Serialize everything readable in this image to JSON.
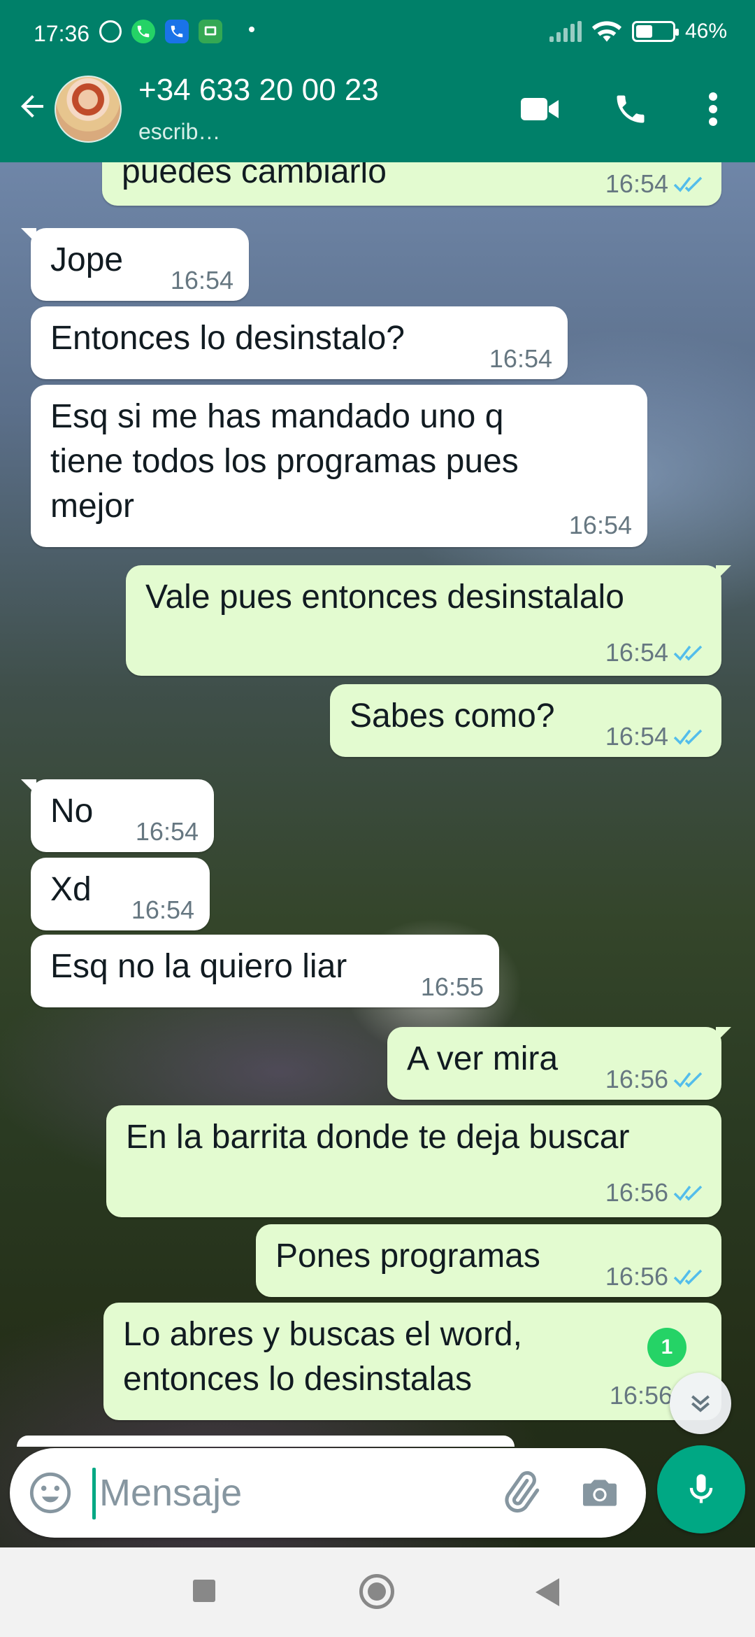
{
  "status_bar": {
    "time": "17:36",
    "battery": "46%",
    "battery_level": 0.46
  },
  "header": {
    "contact_name": "+34 633 20 00 23",
    "contact_status": "escrib…",
    "icons": [
      "back-arrow-icon",
      "video-call-icon",
      "phone-icon",
      "more-vert-icon"
    ]
  },
  "messages": [
    {
      "dir": "out",
      "text": "puedes cambiarlo",
      "time": "16:54",
      "read": true
    },
    {
      "dir": "in",
      "text": "Jope",
      "time": "16:54"
    },
    {
      "dir": "in",
      "text": "Entonces lo desinstalo?",
      "time": "16:54"
    },
    {
      "dir": "in",
      "text": "Esq si me has mandado uno q\ntiene todos los programas pues\nmejor",
      "time": "16:54"
    },
    {
      "dir": "out",
      "text": "Vale pues entonces desinstalalo",
      "time": "16:54",
      "read": true
    },
    {
      "dir": "out",
      "text": "Sabes como?",
      "time": "16:54",
      "read": true
    },
    {
      "dir": "in",
      "text": "No",
      "time": "16:54"
    },
    {
      "dir": "in",
      "text": "Xd",
      "time": "16:54"
    },
    {
      "dir": "in",
      "text": "Esq no la quiero liar",
      "time": "16:55"
    },
    {
      "dir": "out",
      "text": "A ver mira",
      "time": "16:56",
      "read": true
    },
    {
      "dir": "out",
      "text": "En la barrita donde te deja buscar",
      "time": "16:56",
      "read": true
    },
    {
      "dir": "out",
      "text": "Pones programas",
      "time": "16:56",
      "read": true
    },
    {
      "dir": "out",
      "text": "Lo abres y buscas el word,\nentonces lo desinstalas",
      "time": "16:56",
      "read": true
    }
  ],
  "unread_count": "1",
  "composer": {
    "placeholder": "Mensaje"
  },
  "colors": {
    "header": "#008069",
    "outgoing_bubble": "#e3fbd0",
    "incoming_bubble": "#ffffff",
    "read_ticks": "#53bdeb",
    "accent": "#00a884"
  }
}
